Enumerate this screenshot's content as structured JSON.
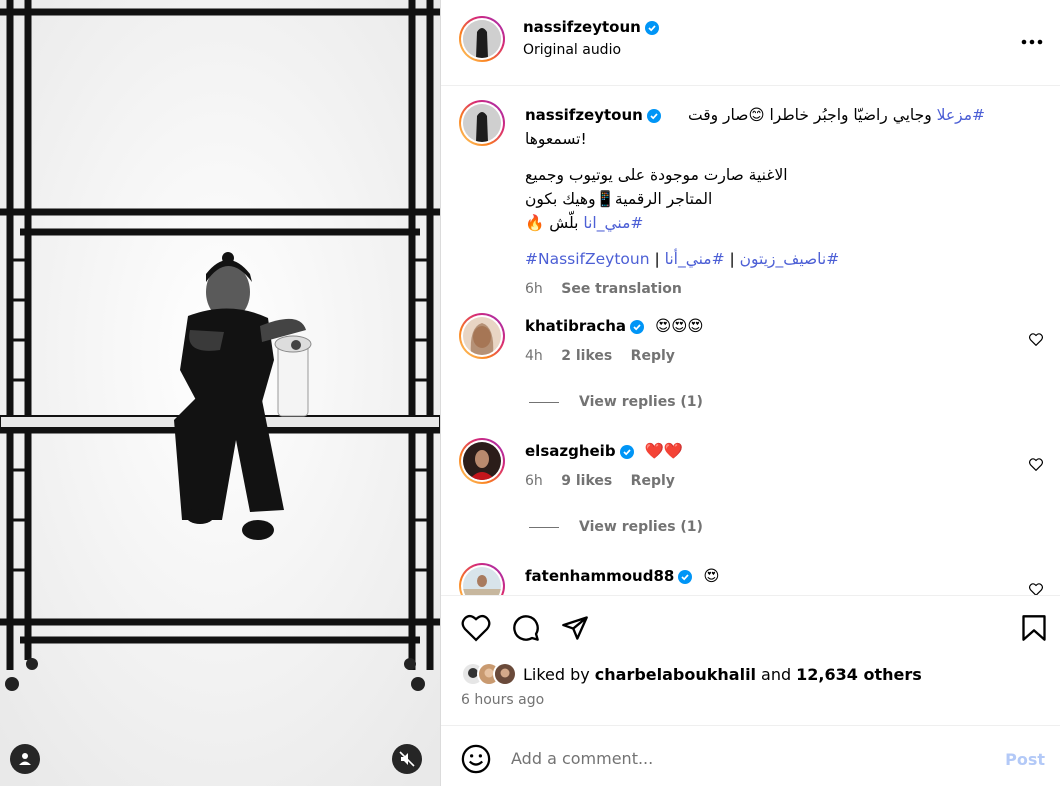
{
  "header": {
    "username": "nassifzeytoun",
    "subtitle": "Original audio",
    "more_icon": "more-horizontal-icon"
  },
  "caption": {
    "username": "nassifzeytoun",
    "line1_hash": "#مزعلا",
    "line1_text": " وجايي راضيّا واجبُر خاطرا 😊صار وقت",
    "line2": "تسمعوها!",
    "line3": "الاغنية صارت موجودة على يوتيوب وجميع المتاجر الرقمية📱وهيك بكون",
    "line4_hash": "#مني_انا",
    "line4_text": " بلّش 🔥",
    "tags_hash1": "#ناصيف_زيتون",
    "tags_sep1": " | ",
    "tags_hash2": "#مني_أنا",
    "tags_sep2": " | ",
    "tags_hash3": "#NassifZeytoun",
    "time": "6h",
    "see_translation": "See translation"
  },
  "comments": [
    {
      "username": "khatibracha",
      "text": "😍😍😍",
      "time": "4h",
      "likes": "2 likes",
      "reply": "Reply",
      "view_replies": "View replies (1)"
    },
    {
      "username": "elsazgheib",
      "text": "❤️❤️",
      "time": "6h",
      "likes": "9 likes",
      "reply": "Reply",
      "view_replies": "View replies (1)"
    },
    {
      "username": "fatenhammoud88",
      "text": "😍"
    }
  ],
  "liked_by": {
    "prefix": "Liked by ",
    "user": "charbelaboukhalil",
    "and": " and ",
    "others": "12,634 others"
  },
  "post_time": "6 hours ago",
  "add_comment": {
    "placeholder": "Add a comment...",
    "post_label": "Post"
  },
  "colors": {
    "link": "#4c5fd5",
    "verified": "#0095f6",
    "muted": "#737373",
    "post_disabled": "#b3c9f7"
  }
}
